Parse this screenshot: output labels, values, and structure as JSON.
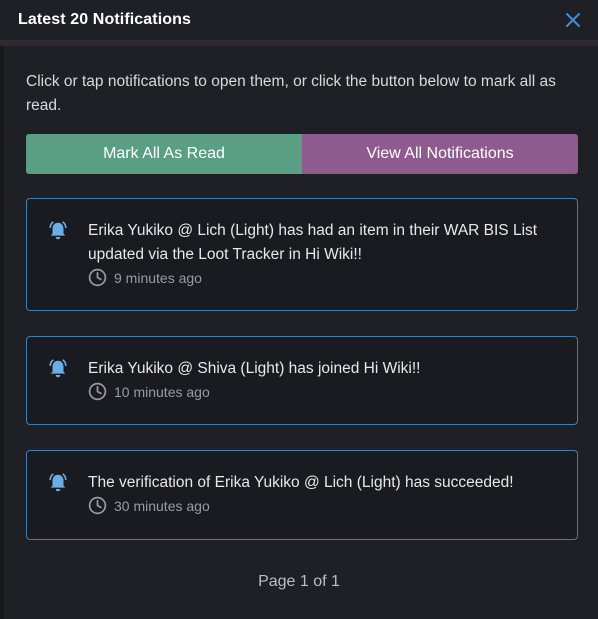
{
  "modal": {
    "title": "Latest 20 Notifications",
    "close_icon": "close-icon",
    "accent_color": "#3d7fb0"
  },
  "intro": "Click or tap notifications to open them, or click the button below to mark all as read.",
  "buttons": {
    "mark_all_read": "Mark All As Read",
    "view_all": "View All Notifications",
    "mark_all_read_color": "#5a9e84",
    "view_all_color": "#8e5b8e"
  },
  "notifications": [
    {
      "icon": "bell-ringing-icon",
      "text": "Erika Yukiko @ Lich (Light) has had an item in their WAR BIS List updated via the Loot Tracker in Hi Wiki!!",
      "time": "9 minutes ago"
    },
    {
      "icon": "bell-ringing-icon",
      "text": "Erika Yukiko @ Shiva (Light) has joined Hi Wiki!!",
      "time": "10 minutes ago"
    },
    {
      "icon": "bell-ringing-icon",
      "text": "The verification of Erika Yukiko @ Lich (Light) has succeeded!",
      "time": "30 minutes ago"
    }
  ],
  "pagination": "Page 1 of 1"
}
